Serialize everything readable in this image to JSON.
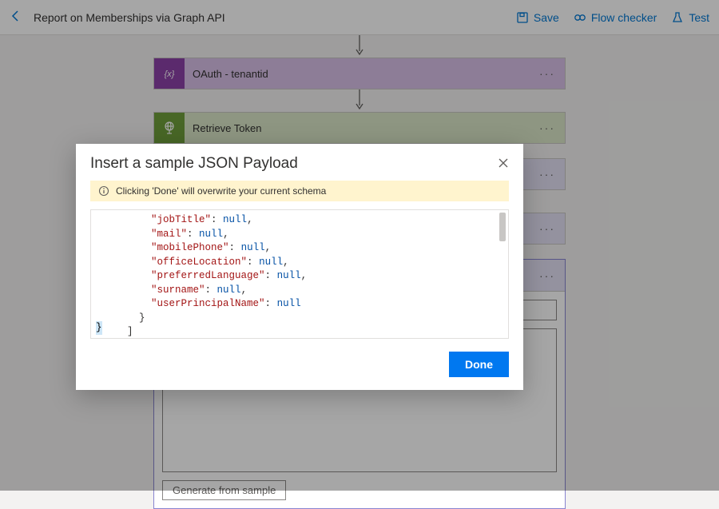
{
  "topbar": {
    "title": "Report on Memberships via Graph API",
    "save": "Save",
    "flow_checker": "Flow checker",
    "test": "Test"
  },
  "cards": {
    "oauth": {
      "label": "OAuth - tenantid"
    },
    "retrieve": {
      "label": "Retrieve Token"
    },
    "generate_btn": "Generate from sample"
  },
  "modal": {
    "title": "Insert a sample JSON Payload",
    "banner": "Clicking 'Done' will overwrite your current schema",
    "done": "Done",
    "json_lines": [
      {
        "indent": 3,
        "key": "jobTitle",
        "val": "null",
        "comma": true
      },
      {
        "indent": 3,
        "key": "mail",
        "val": "null",
        "comma": true
      },
      {
        "indent": 3,
        "key": "mobilePhone",
        "val": "null",
        "comma": true
      },
      {
        "indent": 3,
        "key": "officeLocation",
        "val": "null",
        "comma": true
      },
      {
        "indent": 3,
        "key": "preferredLanguage",
        "val": "null",
        "comma": true
      },
      {
        "indent": 3,
        "key": "surname",
        "val": "null",
        "comma": true
      },
      {
        "indent": 3,
        "key": "userPrincipalName",
        "val": "null",
        "comma": false
      },
      {
        "raw": "    }"
      },
      {
        "raw": "  ]"
      }
    ]
  }
}
